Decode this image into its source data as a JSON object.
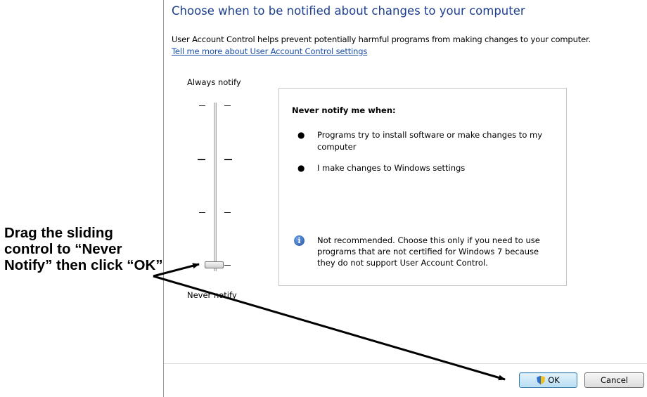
{
  "dialog": {
    "heading": "Choose when to be notified about changes to your computer",
    "description": "User Account Control helps prevent potentially harmful programs from making changes to your computer.",
    "help_link": "Tell me more about User Account Control settings"
  },
  "slider": {
    "top_label": "Always notify",
    "bottom_label": "Never notify",
    "levels": 4,
    "selected_level": 4,
    "selected_label": "Never notify"
  },
  "panel": {
    "title": "Never notify me when:",
    "bullets": [
      "Programs try to install software or make changes to my computer",
      "I make changes to Windows settings"
    ],
    "note": "Not recommended. Choose this only if you need to use programs that are not certified for Windows 7 because they do not support User Account Control."
  },
  "buttons": {
    "ok": "OK",
    "cancel": "Cancel"
  },
  "annotation": {
    "text": "Drag the sliding control to “Never Notify” then click “OK”"
  },
  "icons": {
    "info": "info-icon",
    "uac_shield": "shield-icon"
  }
}
